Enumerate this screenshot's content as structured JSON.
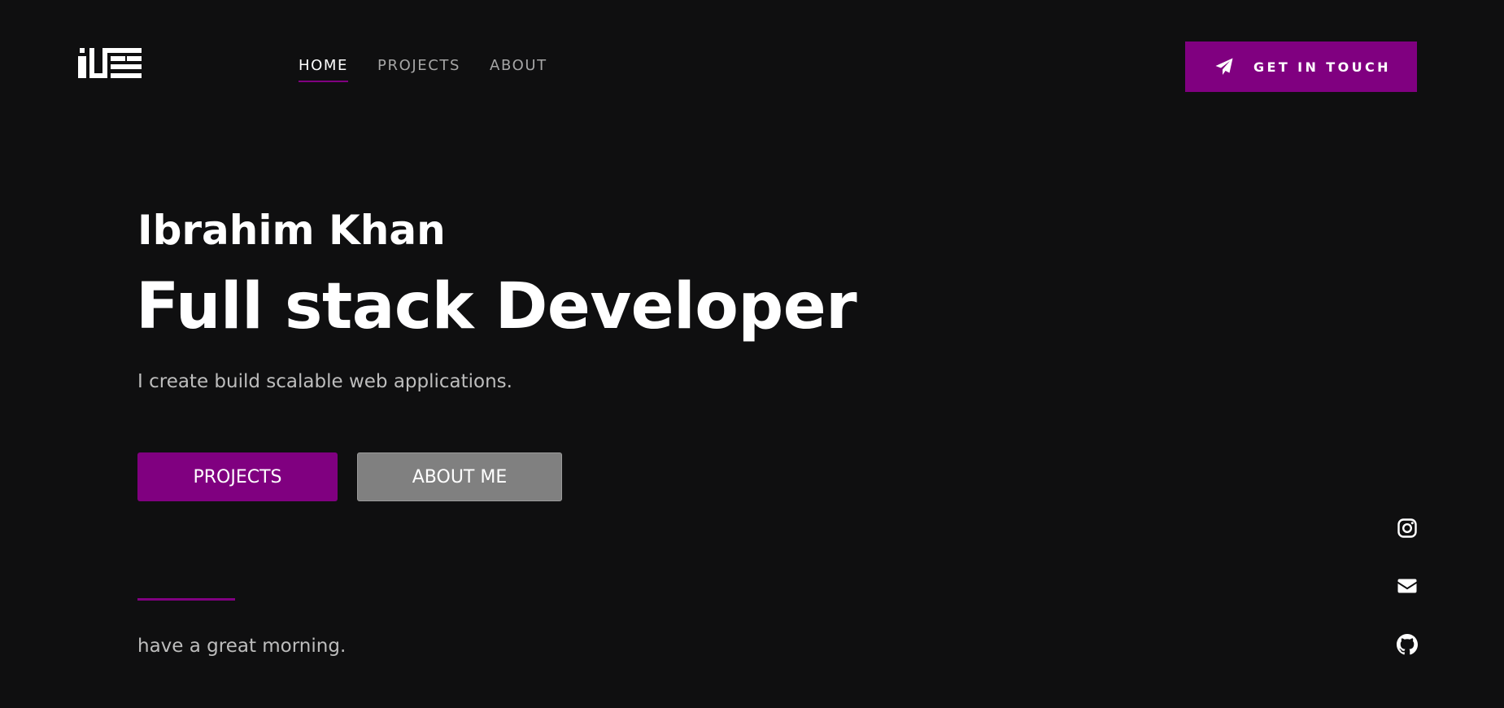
{
  "header": {
    "nav": {
      "items": [
        {
          "label": "HOME",
          "active": true
        },
        {
          "label": "PROJECTS",
          "active": false
        },
        {
          "label": "ABOUT",
          "active": false
        }
      ]
    },
    "cta": {
      "label": "GET IN TOUCH",
      "icon": "paper-plane-icon"
    }
  },
  "hero": {
    "name": "Ibrahim Khan",
    "title": "Full stack Developer",
    "subtitle": "I create build scalable web applications.",
    "buttons": {
      "projects_label": "PROJECTS",
      "about_label": "ABOUT ME"
    },
    "greeting": "have a great morning."
  },
  "socials": [
    {
      "icon": "instagram-icon"
    },
    {
      "icon": "email-icon"
    },
    {
      "icon": "github-icon"
    }
  ],
  "colors": {
    "background": "#0f0f10",
    "accent": "#800080",
    "secondary_button": "#808080",
    "muted_text": "#bdbdbd"
  }
}
